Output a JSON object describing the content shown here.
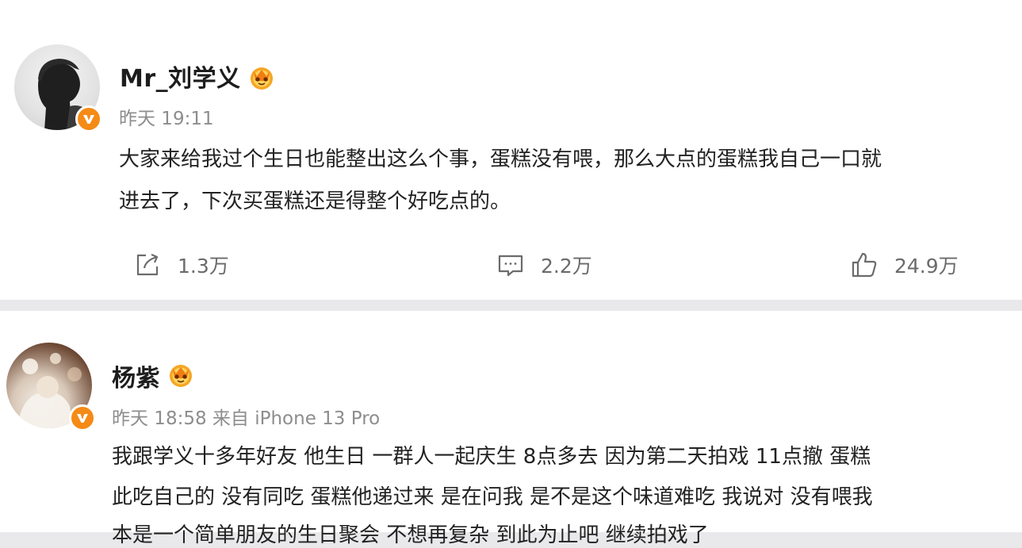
{
  "posts": [
    {
      "username": "Mr_刘学义",
      "meta": "昨天 19:11",
      "lines": [
        "大家来给我过个生日也能整出这么个事，蛋糕没有喂，那么大点的蛋糕我自己一口就",
        "进去了，下次买蛋糕还是得整个好吃点的。"
      ],
      "actions": {
        "repost": "1.3万",
        "comment": "2.2万",
        "like": "24.9万"
      },
      "icons": {
        "avatar": "avatar-silhouette",
        "badge": "verified-v-icon",
        "crown": "vip-crown-icon"
      }
    },
    {
      "username": "杨紫",
      "meta": "昨天 18:58 来自 iPhone 13 Pro",
      "lines": [
        "我跟学义十多年好友 他生日 一群人一起庆生 8点多去 因为第二天拍戏 11点撤 蛋糕",
        "此吃自己的 没有同吃 蛋糕他递过来 是在问我 是不是这个味道难吃 我说对 没有喂我",
        "本是一个简单朋友的生日聚会 不想再复杂 到此为止吧 继续拍戏了"
      ],
      "icons": {
        "avatar": "avatar-photo",
        "badge": "verified-v-icon",
        "crown": "vip-crown-icon"
      }
    }
  ],
  "colors": {
    "badge": "#f58a16",
    "text": "#222222",
    "meta": "#8d8d8d",
    "action": "#6b6b6b",
    "separator": "#e9e9ec"
  }
}
